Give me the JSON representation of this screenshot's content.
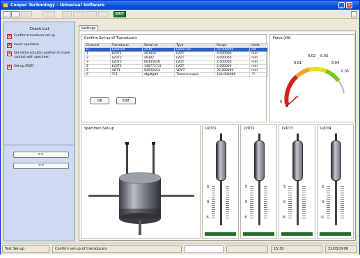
{
  "window": {
    "title": "Cooper Technology - Universal Software"
  },
  "toolbar": {
    "exit_label": "EXIT"
  },
  "checklist": {
    "header": "Check List",
    "items": [
      {
        "label": "Confirm transducer set up",
        "mark": "X"
      },
      {
        "label": "Insert specimen",
        "mark": "X"
      },
      {
        "label": "Set initial actuator position to make contact with specimen",
        "mark": "X"
      },
      {
        "label": "Set-up (RDT)",
        "mark": "X"
      }
    ],
    "next_label": ">>",
    "prev_label": "<<"
  },
  "main": {
    "tab_label": "Settings",
    "transducers": {
      "title": "Confirm Set-up of Transducers",
      "columns": [
        "Channel",
        "Transducer",
        "Serial no",
        "Type",
        "Range",
        "Units"
      ],
      "rows": [
        [
          "0",
          "Loadcell",
          "2534",
          "Load Cell",
          "25.000000",
          "kN"
        ],
        [
          "1",
          "LVDT1",
          "403434",
          "LVDT",
          "4.000000",
          "mm"
        ],
        [
          "2",
          "LVDT2",
          "40342",
          "LVDT",
          "4.000000",
          "mm"
        ],
        [
          "3",
          "LVDT3",
          "66345659",
          "LVDT",
          "2.000000",
          "mm"
        ],
        [
          "4",
          "LVDT4",
          "34677272t",
          "LVDT",
          "2.000000",
          "mm"
        ],
        [
          "5",
          "VDT1",
          "93535454",
          "VDVT",
          "35.000000",
          "mm"
        ],
        [
          "6",
          "TC1",
          "dfgdfgdd",
          "Thermocouple",
          "100.000000",
          "°C"
        ]
      ],
      "selected_row": 0,
      "ok_label": "OK",
      "edit_label": "Edit"
    },
    "force": {
      "title": "Force (kN)",
      "ticks": [
        "0",
        "0.01",
        "0.02",
        "0.03",
        "0.04",
        "0.05"
      ]
    },
    "specimen": {
      "title": "Specimen Set-up"
    },
    "lvdts": [
      {
        "label": "LVDT1",
        "scale_top": "5",
        "scale_mid": "0",
        "scale_bot": "-5"
      },
      {
        "label": "LVDT2",
        "scale_top": "5",
        "scale_mid": "0",
        "scale_bot": "-5"
      },
      {
        "label": "LVDT3",
        "scale_top": "5",
        "scale_mid": "0",
        "scale_bot": "-5"
      },
      {
        "label": "LVDT4",
        "scale_top": "5",
        "scale_mid": "0",
        "scale_bot": "-5"
      }
    ]
  },
  "status": {
    "panel1": "Test Set-up",
    "panel2": "Confirm set-up of transducers",
    "time": "15:30",
    "date": "31/03/2006"
  }
}
